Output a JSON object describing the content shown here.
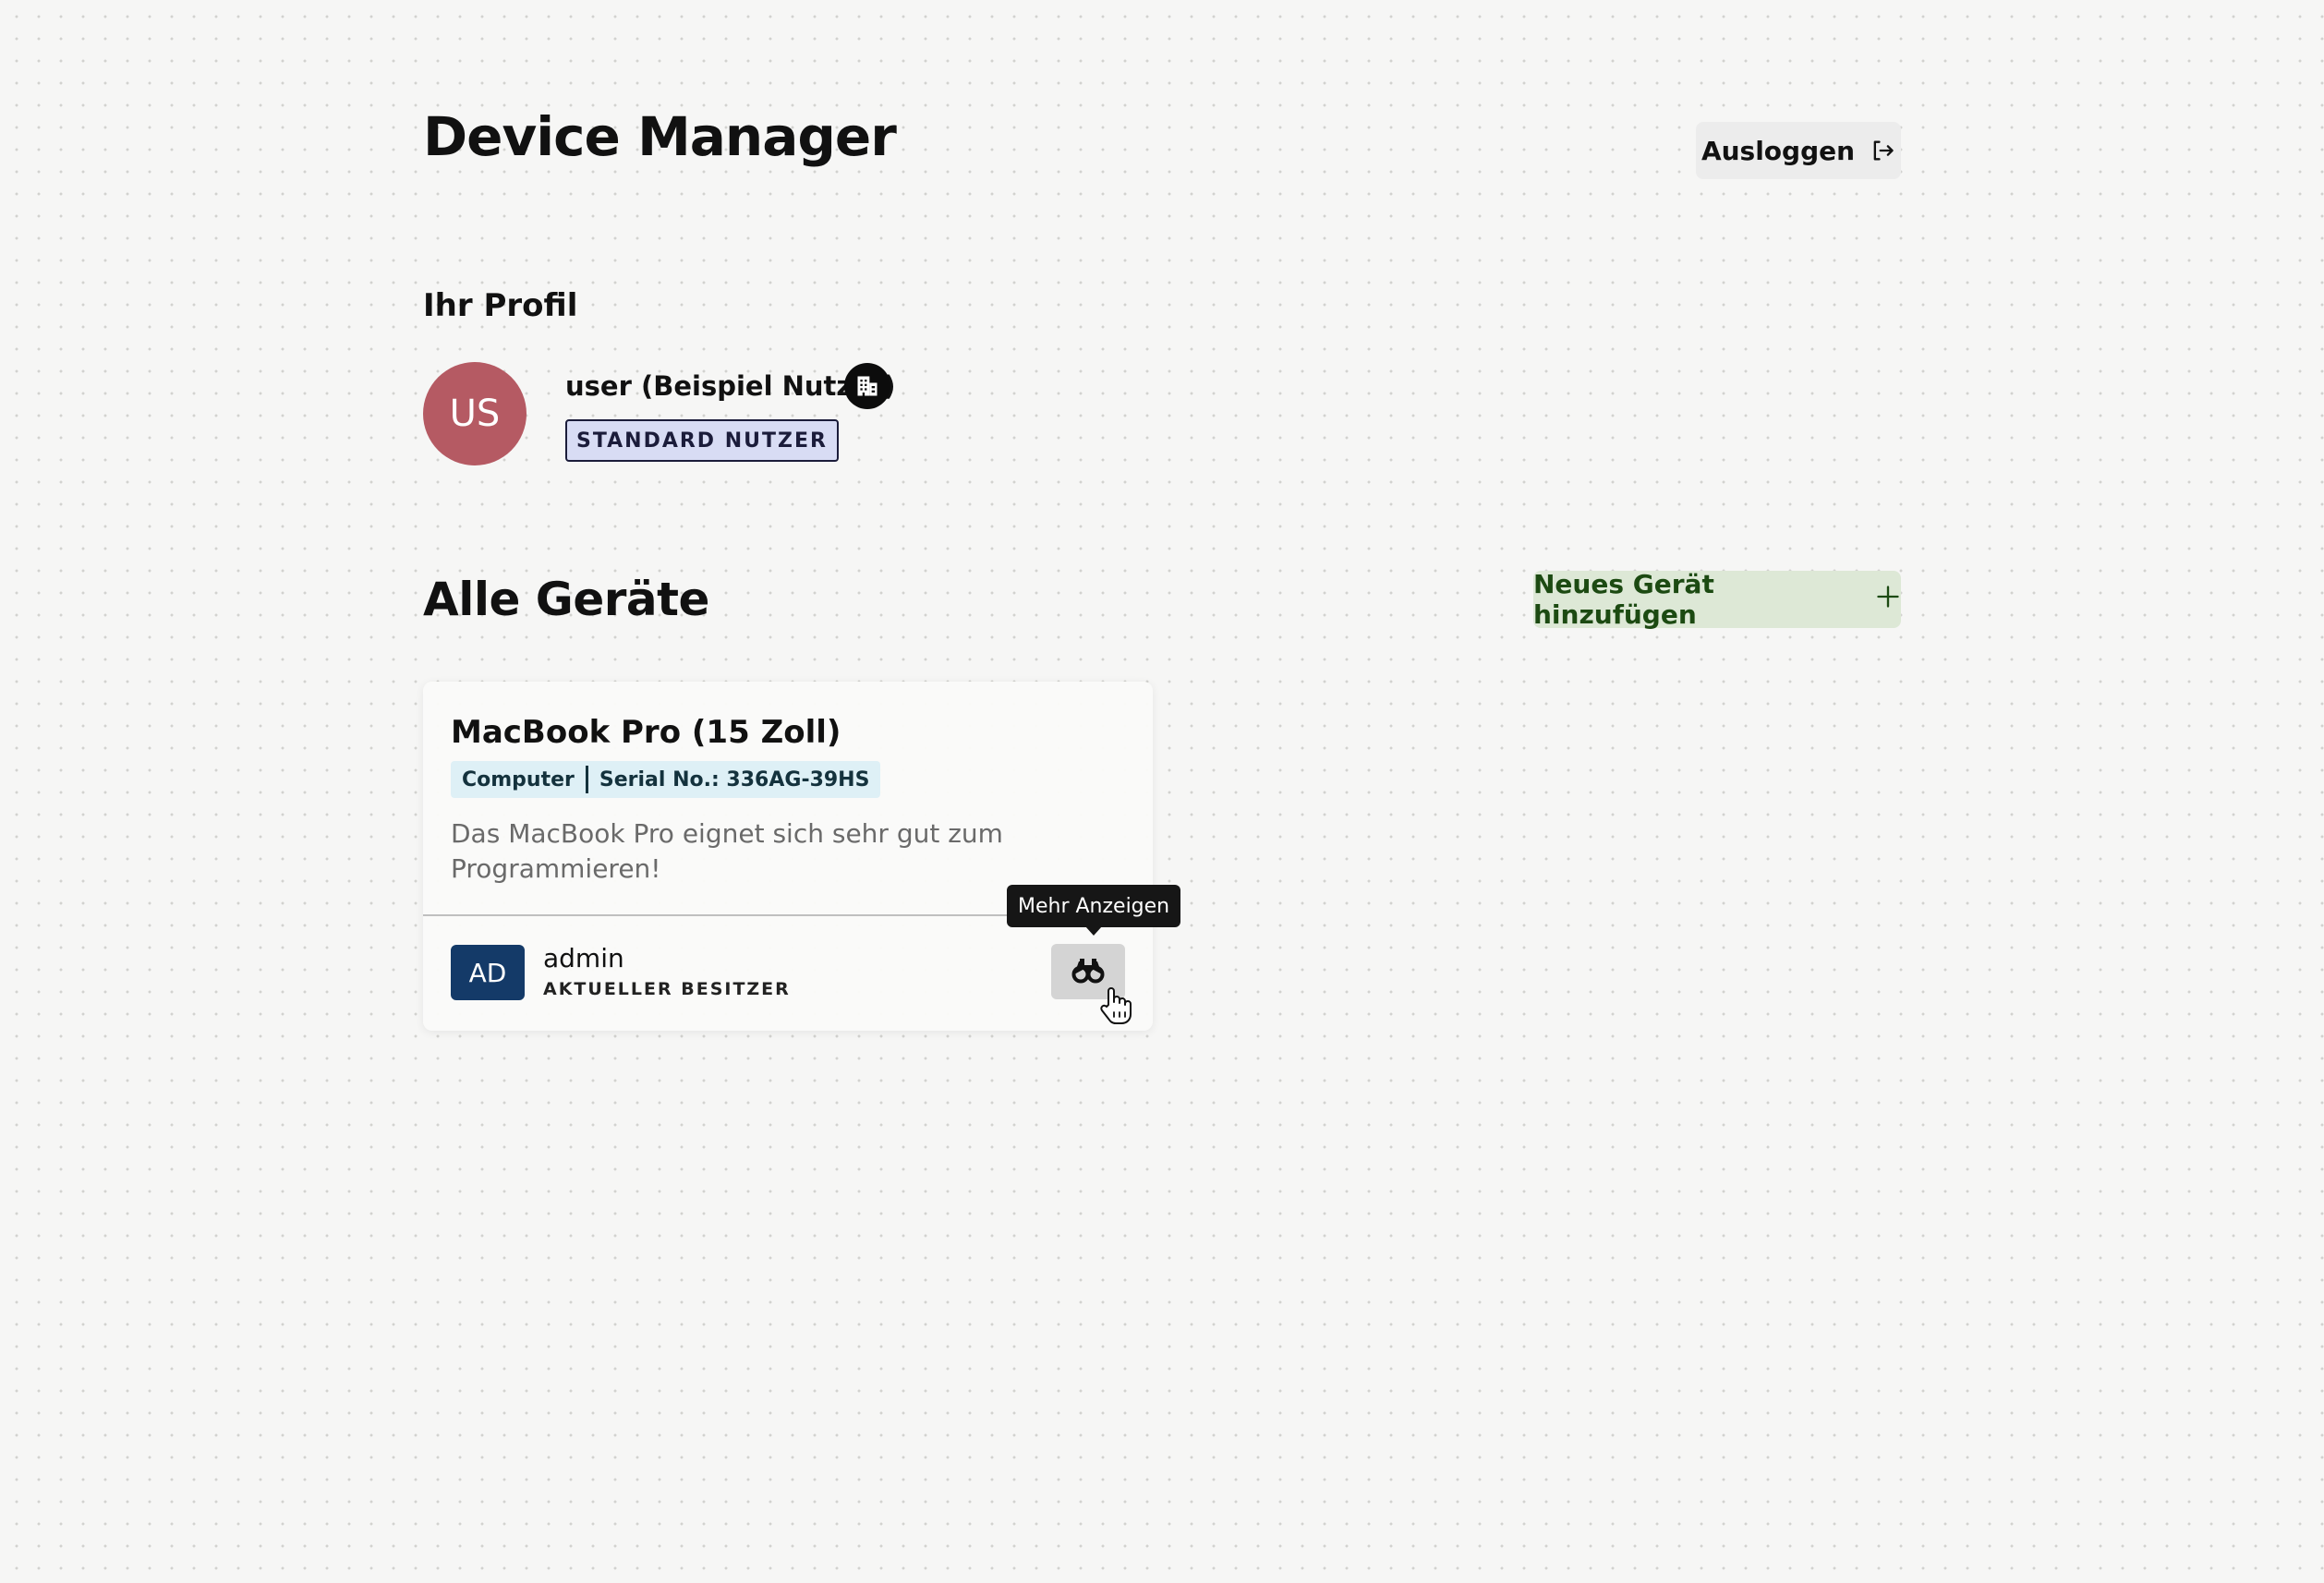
{
  "header": {
    "title": "Device Manager",
    "logout_label": "Ausloggen",
    "logout_icon": "logout-icon"
  },
  "profile": {
    "section_title": "Ihr Profil",
    "avatar_initials": "US",
    "avatar_color": "#b55a63",
    "name": "user (Beispiel Nutzer)",
    "org_icon": "building-icon",
    "role_badge": "STANDARD NUTZER"
  },
  "devices": {
    "section_title": "Alle Geräte",
    "add_button_label": "Neues Gerät hinzufügen",
    "add_icon": "plus-icon",
    "items": [
      {
        "name": "MacBook Pro (15 Zoll)",
        "category": "Computer",
        "serial": "Serial No.: 336AG-39HS",
        "description": "Das MacBook Pro eignet sich sehr gut zum Programmieren!",
        "owner_initials": "AD",
        "owner_color": "#143a68",
        "owner_name": "admin",
        "owner_label": "AKTUELLER BESITZER",
        "view_icon": "binoculars-icon",
        "view_tooltip": "Mehr Anzeigen"
      }
    ]
  }
}
